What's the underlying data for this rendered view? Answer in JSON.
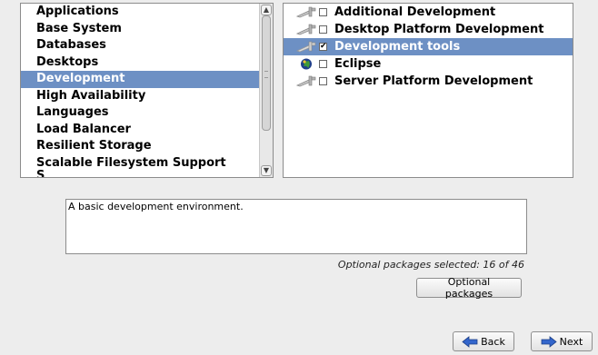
{
  "categories": {
    "items": [
      {
        "label": "Applications"
      },
      {
        "label": "Base System"
      },
      {
        "label": "Databases"
      },
      {
        "label": "Desktops"
      },
      {
        "label": "Development",
        "selected": true
      },
      {
        "label": "High Availability"
      },
      {
        "label": "Languages"
      },
      {
        "label": "Load Balancer"
      },
      {
        "label": "Resilient Storage"
      },
      {
        "label": "Scalable Filesystem Support"
      },
      {
        "label": "S"
      }
    ]
  },
  "packages": {
    "items": [
      {
        "label": "Additional Development",
        "checked": false,
        "icon": "package-tools-icon"
      },
      {
        "label": "Desktop Platform Development",
        "checked": false,
        "icon": "package-tools-icon"
      },
      {
        "label": "Development tools",
        "checked": true,
        "selected": true,
        "icon": "package-tools-icon"
      },
      {
        "label": "Eclipse",
        "checked": false,
        "icon": "eclipse-globe-icon"
      },
      {
        "label": "Server Platform Development",
        "checked": false,
        "icon": "package-tools-icon"
      }
    ],
    "check_mark": "✔"
  },
  "description": "A basic development environment.",
  "optional_count_text": "Optional packages selected: 16 of 46",
  "buttons": {
    "optional_packages": "Optional packages",
    "back": "Back",
    "next": "Next"
  },
  "colors": {
    "selection": "#6d90c4",
    "background": "#ededed",
    "arrow": "#3366cc"
  }
}
